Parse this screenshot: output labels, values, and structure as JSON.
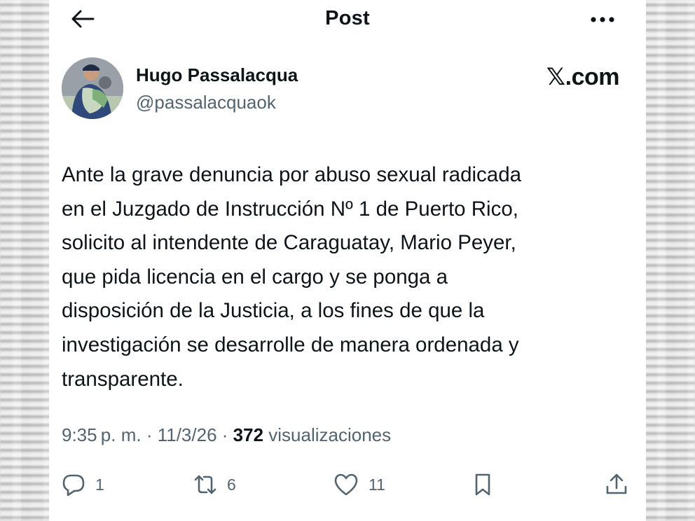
{
  "header": {
    "title": "Post"
  },
  "author": {
    "name": "Hugo Passalacqua",
    "handle": "@passalacquaok"
  },
  "brand": "𝕏.com",
  "post": {
    "lines": [
      "Ante la grave denuncia por abuso sexual radicada",
      "en el Juzgado de Instrucción Nº 1 de Puerto Rico,",
      "solicito al intendente de Caraguatay, Mario Peyer,",
      "que pida licencia en el cargo y se ponga a",
      "disposición de la Justicia, a los fines de que la",
      "investigación se desarrolle de manera ordenada y",
      "transparente."
    ]
  },
  "meta": {
    "time": "9:35 p. m.",
    "sep1": " · ",
    "date": "11/3/26",
    "sep2": " · ",
    "views_count": "372",
    "views_label": " visualizaciones"
  },
  "actions": {
    "replies": "1",
    "reposts": "6",
    "likes": "11"
  },
  "icons": {
    "back": "arrow-left-icon",
    "more": "more-horizontal-icon",
    "reply": "reply-icon",
    "repost": "repost-icon",
    "like": "heart-icon",
    "bookmark": "bookmark-icon",
    "share": "share-icon"
  }
}
